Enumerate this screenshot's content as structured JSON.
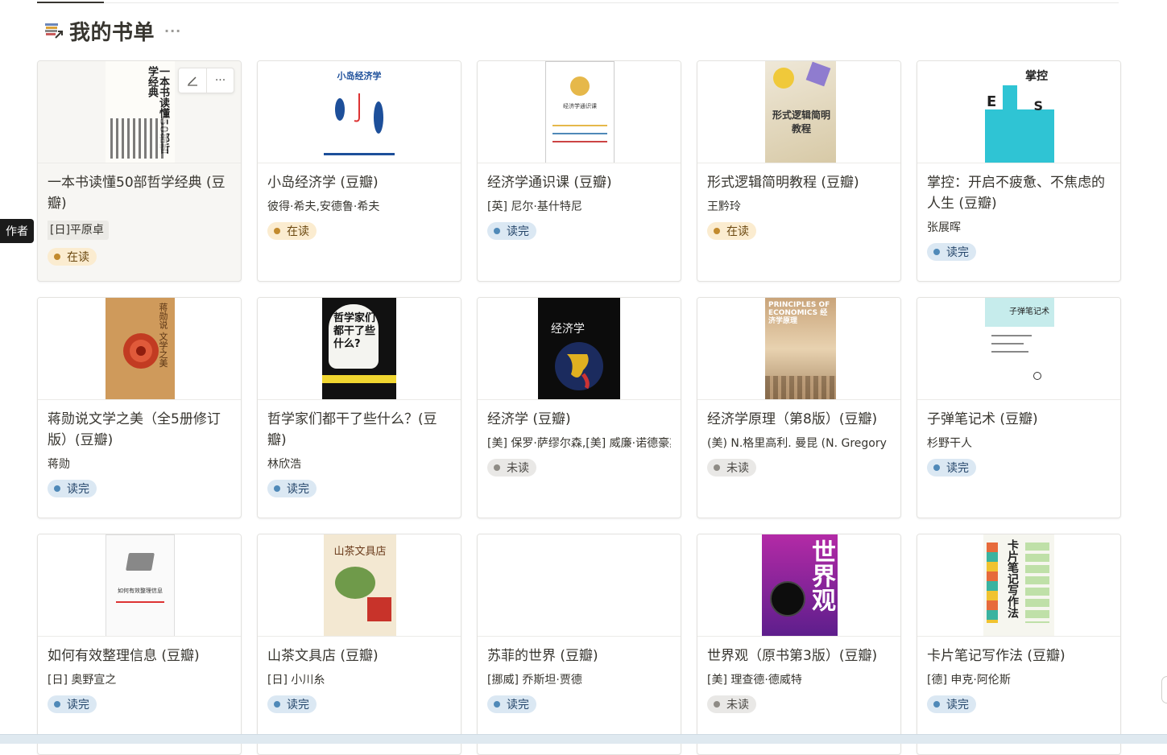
{
  "database": {
    "title": "我的书单",
    "more_label": "···",
    "icon": "books-link-icon"
  },
  "tooltip": "作者",
  "card_actions": {
    "edit_icon": "pencil-icon",
    "more_label": "···"
  },
  "cards": [
    {
      "title": "一本书读懂50部哲学经典 (豆瓣)",
      "author": "[日]平原卓",
      "status": "在读",
      "status_kind": "reading",
      "cover_text": "一本书读懂50部哲学经典"
    },
    {
      "title": "小岛经济学 (豆瓣)",
      "author": "彼得·希夫,安德鲁·希夫",
      "status": "在读",
      "status_kind": "reading",
      "cover_text": "小岛经济学"
    },
    {
      "title": "经济学通识课 (豆瓣)",
      "author": "[英] 尼尔·基什特尼",
      "status": "读完",
      "status_kind": "done",
      "cover_text": "经济学通识课"
    },
    {
      "title": "形式逻辑简明教程 (豆瓣)",
      "author": "王黔玲",
      "status": "在读",
      "status_kind": "reading",
      "cover_text": "形式逻辑简明教程"
    },
    {
      "title": "掌控：开启不疲惫、不焦虑的人生 (豆瓣)",
      "author": "张展晖",
      "status": "读完",
      "status_kind": "done",
      "cover_text": "掌控"
    },
    {
      "title": "蒋勋说文学之美（全5册修订版）(豆瓣)",
      "author": "蒋勋",
      "status": "读完",
      "status_kind": "done",
      "cover_text": "蒋勋说 文学之美"
    },
    {
      "title": "哲学家们都干了些什么？(豆瓣)",
      "author": "林欣浩",
      "status": "读完",
      "status_kind": "done",
      "cover_text": "哲学家们都干了些什么?"
    },
    {
      "title": "经济学 (豆瓣)",
      "author": "[美] 保罗·萨缪尔森,[美] 威廉·诺德豪斯",
      "status": "未读",
      "status_kind": "unread",
      "cover_text": "经济学"
    },
    {
      "title": "经济学原理（第8版）(豆瓣)",
      "author": "(美) N.格里高利. 曼昆 (N. Gregory Mankiw)",
      "status": "未读",
      "status_kind": "unread",
      "cover_text": "PRINCIPLES OF ECONOMICS 经济学原理"
    },
    {
      "title": "子弹笔记术 (豆瓣)",
      "author": "杉野干人",
      "status": "读完",
      "status_kind": "done",
      "cover_text": "子弹笔记术"
    },
    {
      "title": "如何有效整理信息 (豆瓣)",
      "author": "[日] 奥野宣之",
      "status": "读完",
      "status_kind": "done",
      "cover_text": "如何有效整理信息"
    },
    {
      "title": "山茶文具店 (豆瓣)",
      "author": "[日] 小川糸",
      "status": "读完",
      "status_kind": "done",
      "cover_text": "山茶文具店"
    },
    {
      "title": "苏菲的世界 (豆瓣)",
      "author": "[挪威] 乔斯坦·贾德",
      "status": "读完",
      "status_kind": "done",
      "cover_text": ""
    },
    {
      "title": "世界观（原书第3版）(豆瓣)",
      "author": "[美] 理查德·德威特",
      "status": "未读",
      "status_kind": "unread",
      "cover_text": "世界观"
    },
    {
      "title": "卡片笔记写作法 (豆瓣)",
      "author": "[德] 申克·阿伦斯",
      "status": "读完",
      "status_kind": "done",
      "cover_text": "卡片笔记写作法"
    }
  ]
}
